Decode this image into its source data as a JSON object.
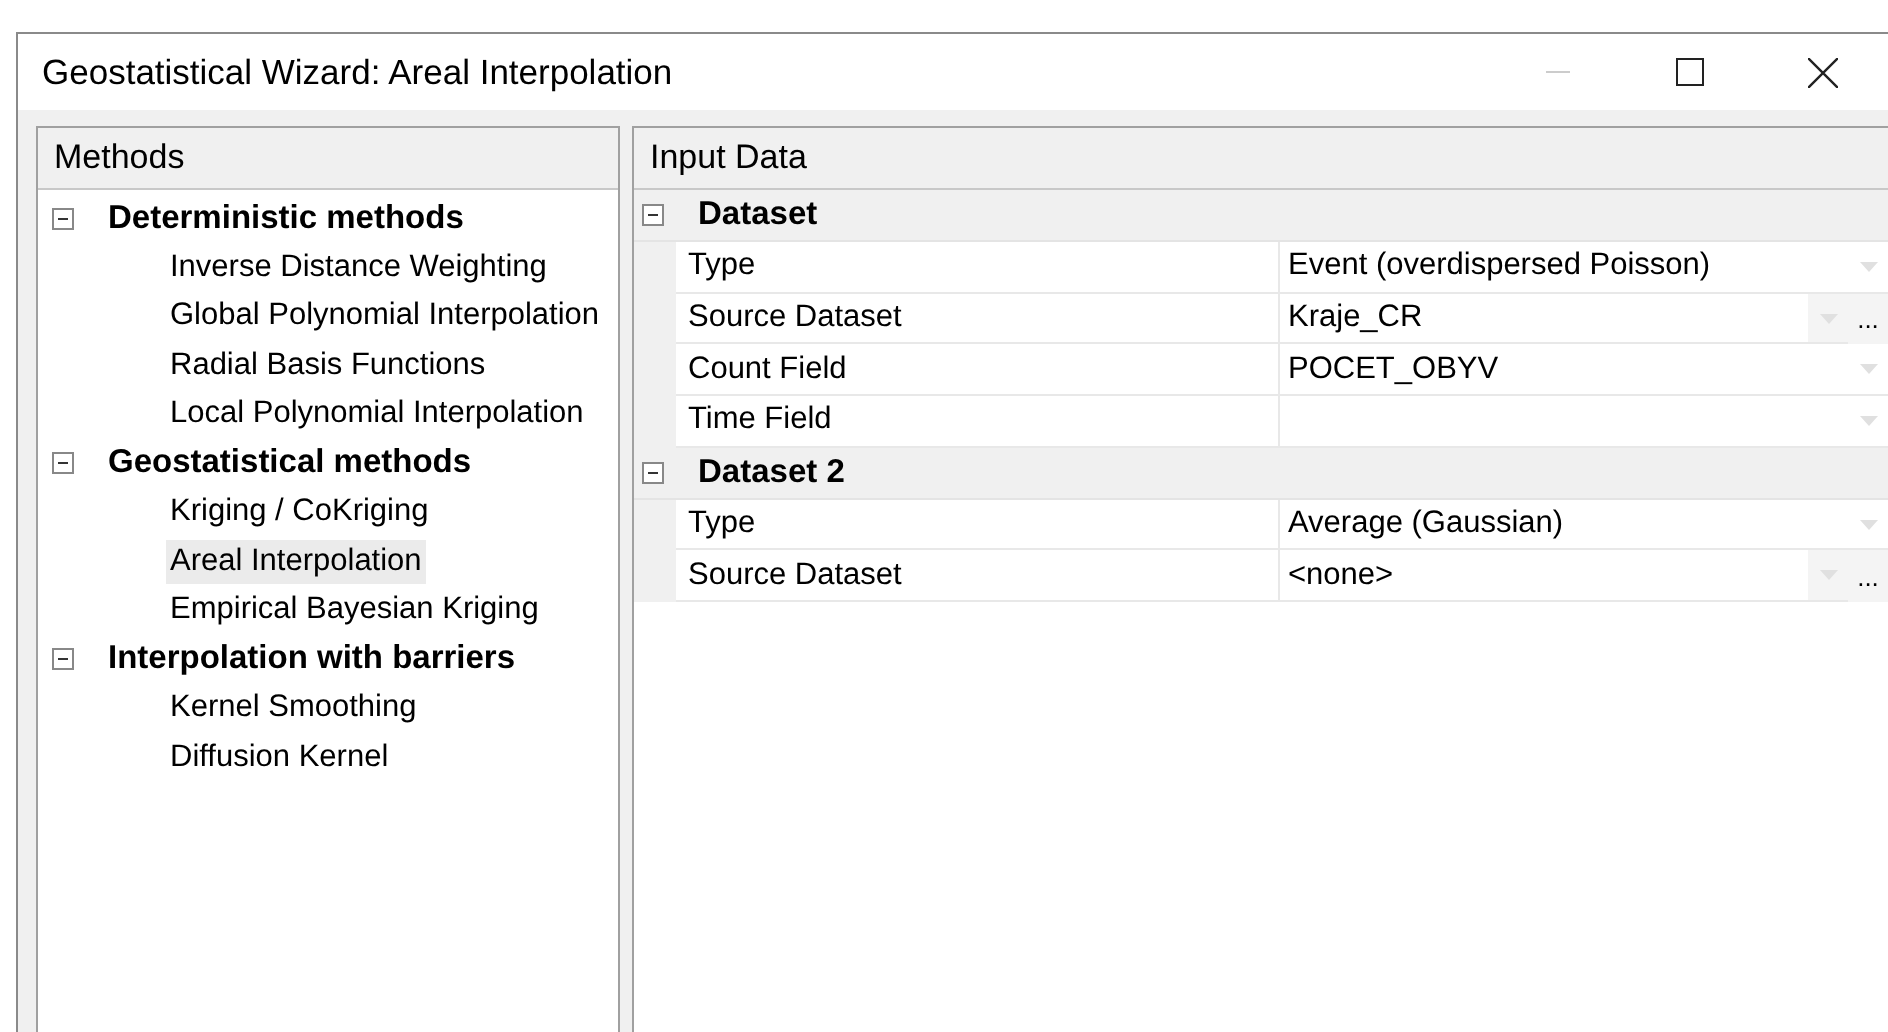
{
  "window": {
    "title": "Geostatistical Wizard: Areal Interpolation"
  },
  "methods": {
    "header": "Methods",
    "groups": [
      {
        "label": "Deterministic methods",
        "expanded": true,
        "children": [
          {
            "label": "Inverse Distance Weighting",
            "selected": false
          },
          {
            "label": "Global Polynomial Interpolation",
            "selected": false
          },
          {
            "label": "Radial Basis Functions",
            "selected": false
          },
          {
            "label": "Local Polynomial Interpolation",
            "selected": false
          }
        ]
      },
      {
        "label": "Geostatistical methods",
        "expanded": true,
        "children": [
          {
            "label": "Kriging / CoKriging",
            "selected": false
          },
          {
            "label": "Areal Interpolation",
            "selected": true
          },
          {
            "label": "Empirical Bayesian Kriging",
            "selected": false
          }
        ]
      },
      {
        "label": "Interpolation with barriers",
        "expanded": true,
        "children": [
          {
            "label": "Kernel Smoothing",
            "selected": false
          },
          {
            "label": "Diffusion Kernel",
            "selected": false
          }
        ]
      }
    ]
  },
  "input_data": {
    "header": "Input Data",
    "groups": [
      {
        "label": "Dataset",
        "expanded": true,
        "rows": [
          {
            "name": "Type",
            "value": "Event (overdispersed Poisson)"
          },
          {
            "name": "Source Dataset",
            "value": "Kraje_CR",
            "button": "..."
          },
          {
            "name": "Count Field",
            "value": "POCET_OBYV"
          },
          {
            "name": "Time Field",
            "value": ""
          }
        ]
      },
      {
        "label": "Dataset 2",
        "expanded": true,
        "rows": [
          {
            "name": "Type",
            "value": "Average (Gaussian)"
          },
          {
            "name": "Source Dataset",
            "value": "<none>",
            "button": "..."
          }
        ]
      }
    ]
  }
}
